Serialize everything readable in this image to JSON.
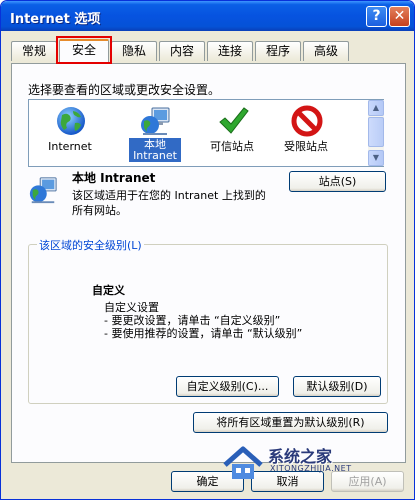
{
  "window": {
    "title": "Internet 选项"
  },
  "titlebar": {
    "help_glyph": "?",
    "close_glyph": "✕"
  },
  "tabs": [
    {
      "label": "常规",
      "active": false
    },
    {
      "label": "安全",
      "active": true
    },
    {
      "label": "隐私",
      "active": false
    },
    {
      "label": "内容",
      "active": false
    },
    {
      "label": "连接",
      "active": false
    },
    {
      "label": "程序",
      "active": false
    },
    {
      "label": "高级",
      "active": false
    }
  ],
  "security": {
    "zone_prompt": "选择要查看的区域或更改安全设置。",
    "zones": [
      {
        "label": "Internet",
        "icon": "globe-icon",
        "selected": false
      },
      {
        "label": "本地\nIntranet",
        "icon": "local-intranet-icon",
        "selected": true
      },
      {
        "label": "可信站点",
        "icon": "checkmark-icon",
        "selected": false
      },
      {
        "label": "受限站点",
        "icon": "prohibited-icon",
        "selected": false
      }
    ],
    "selected_zone": {
      "name": "本地 Intranet",
      "description": "该区域适用于在您的 Intranet 上找到的所有网站。"
    },
    "sites_button": "站点(S)",
    "level_group": {
      "legend": "该区域的安全级别(L)",
      "level_name": "自定义",
      "desc_1": "自定义设置",
      "desc_2": "- 要更改设置，请单击 “自定义级别”",
      "desc_3": "- 要使用推荐的设置，请单击 “默认级别”",
      "custom_level_button": "自定义级别(C)...",
      "default_level_button": "默认级别(D)"
    },
    "reset_all_button": "将所有区域重置为默认级别(R)"
  },
  "dialog_buttons": {
    "ok": "确定",
    "cancel": "取消",
    "apply": "应用(A)"
  },
  "watermark": {
    "title": "系统之家",
    "subtitle": "XITONGZHIJIA.NET"
  },
  "colors": {
    "titlebar": "#0653e0",
    "selection": "#316ac5",
    "highlight_box": "#e40000",
    "tab_accent": "#e68b2c"
  }
}
